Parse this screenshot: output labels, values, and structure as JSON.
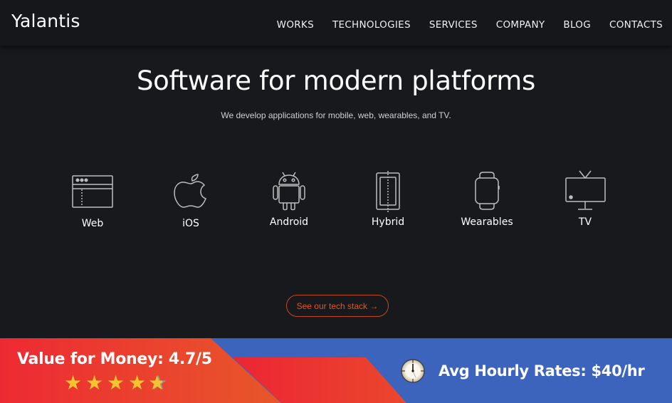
{
  "header": {
    "logo": "Yalantis",
    "nav": [
      "WORKS",
      "TECHNOLOGIES",
      "SERVICES",
      "COMPANY",
      "BLOG",
      "CONTACTS"
    ]
  },
  "hero": {
    "title": "Software for modern platforms",
    "subtitle": "We develop applications for mobile, web, wearables, and TV."
  },
  "platforms": [
    {
      "label": "Web",
      "icon": "browser-window-icon"
    },
    {
      "label": "iOS",
      "icon": "apple-icon"
    },
    {
      "label": "Android",
      "icon": "android-icon"
    },
    {
      "label": "Hybrid",
      "icon": "hybrid-device-icon"
    },
    {
      "label": "Wearables",
      "icon": "smartwatch-icon"
    },
    {
      "label": "TV",
      "icon": "tv-icon"
    }
  ],
  "cta": {
    "label": "See our tech stack →"
  },
  "banner": {
    "value_label": "Value for Money: 4.7/5",
    "rating": 4.7,
    "rating_max": 5,
    "rate_label": "Avg Hourly Rates: $40/hr",
    "colors": {
      "red": "#ed2a33",
      "orange": "#e8572a",
      "blue": "#3c64bc",
      "star": "#f2c530"
    }
  }
}
